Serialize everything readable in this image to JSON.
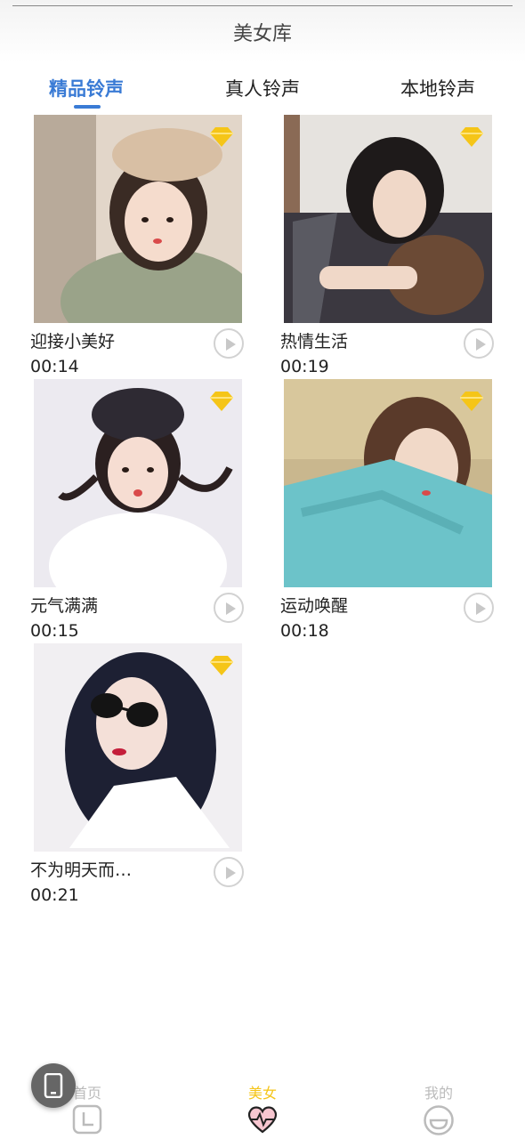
{
  "header": {
    "title": "美女库"
  },
  "tabs": [
    {
      "label": "精品铃声",
      "active": true
    },
    {
      "label": "真人铃声",
      "active": false
    },
    {
      "label": "本地铃声",
      "active": false
    }
  ],
  "ringtones": [
    {
      "title": "迎接小美好",
      "duration": "00:14",
      "premium": true
    },
    {
      "title": "热情生活",
      "duration": "00:19",
      "premium": true
    },
    {
      "title": "元气满满",
      "duration": "00:15",
      "premium": true
    },
    {
      "title": "运动唤醒",
      "duration": "00:18",
      "premium": true
    },
    {
      "title": "不为明天而…",
      "duration": "00:21",
      "premium": true
    }
  ],
  "bottom_nav": [
    {
      "label": "首页",
      "icon": "clock-icon",
      "active": false
    },
    {
      "label": "美女",
      "icon": "heart-icon",
      "active": true
    },
    {
      "label": "我的",
      "icon": "smile-icon",
      "active": false
    }
  ],
  "colors": {
    "accent": "#3a7bd5",
    "premium": "#f5c518",
    "nav_active": "#f5c518"
  }
}
